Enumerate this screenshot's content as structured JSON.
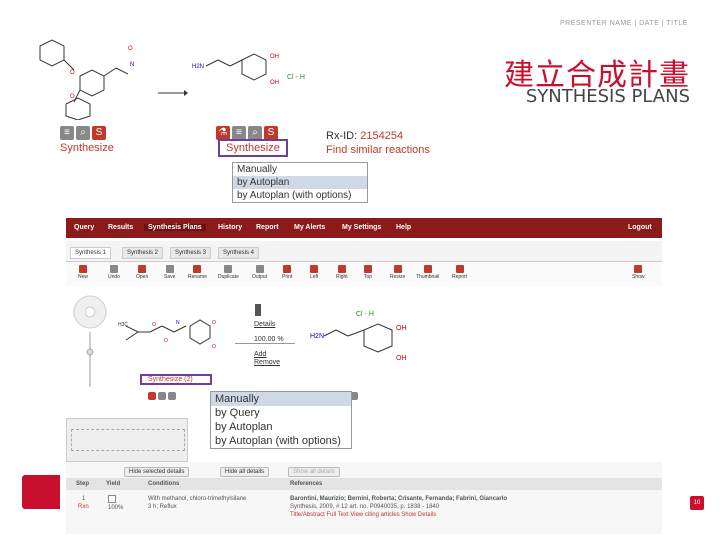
{
  "header": {
    "meta": "PRESENTER NAME | DATE | TITLE",
    "title_zh": "建立合成計畫",
    "title_en": "SYNTHESIS PLANS"
  },
  "top": {
    "synthesize_left": "Synthesize",
    "synthesize_mid": "Synthesize",
    "rx_label": "Rx-ID:",
    "rx_id": "2154254",
    "find_similar": "Find similar reactions",
    "salt_label": "Cl - H",
    "dropdown_small": [
      "Manually",
      "by Autoplan",
      "by Autoplan (with options)"
    ]
  },
  "nav": {
    "items": [
      "Query",
      "Results",
      "Synthesis Plans",
      "History",
      "Report",
      "My Alerts",
      "My Settings",
      "Help"
    ],
    "logout": "Logout"
  },
  "tabs": [
    "Synthesis 1",
    "Synthesis 2",
    "Synthesis 3",
    "Synthesis 4"
  ],
  "toolbar": [
    "New",
    "Undo",
    "Open",
    "Save",
    "Rename",
    "Duplicate",
    "Output",
    "Print",
    "Left",
    "Right",
    "Top",
    "Resize",
    "Thumbnail",
    "Report",
    "Show"
  ],
  "canvas": {
    "details": "Details",
    "yield": "100.00 %",
    "add": "Add",
    "remove": "Remove",
    "salt_label": "Cl - H",
    "synth_link": "Synthesize (2)",
    "dropdown_large": [
      "Manually",
      "by Query",
      "by Autoplan",
      "by Autoplan (with options)"
    ]
  },
  "bottom": {
    "buttons": [
      "Hide selected details",
      "Hide all details",
      "Show all details"
    ],
    "headers": [
      "Step",
      "Yield",
      "Conditions",
      "References"
    ],
    "row": {
      "step": "1",
      "step_sub": "Rxn",
      "yield": "100%",
      "conditions": "With methanol, chloro-trimethylsilane",
      "conditions_sub": "3 h; Reflux",
      "refs": "Barontini, Maurizio; Bernini, Roberta; Crisante, Fernanda; Fabrini, Giancarlo",
      "refs_sub": "Synthesis, 2009, # 12 art. no. P0940035, p. 1838 - 1840",
      "refs_links": "Title/Abstract   Full Text   View citing articles   Show Details"
    }
  },
  "footer": {
    "page": "10"
  },
  "colors": {
    "brand": "#c8102e",
    "nav": "#8b1a1a",
    "highlight": "#cfd8e6",
    "box": "#6a3fa0"
  }
}
